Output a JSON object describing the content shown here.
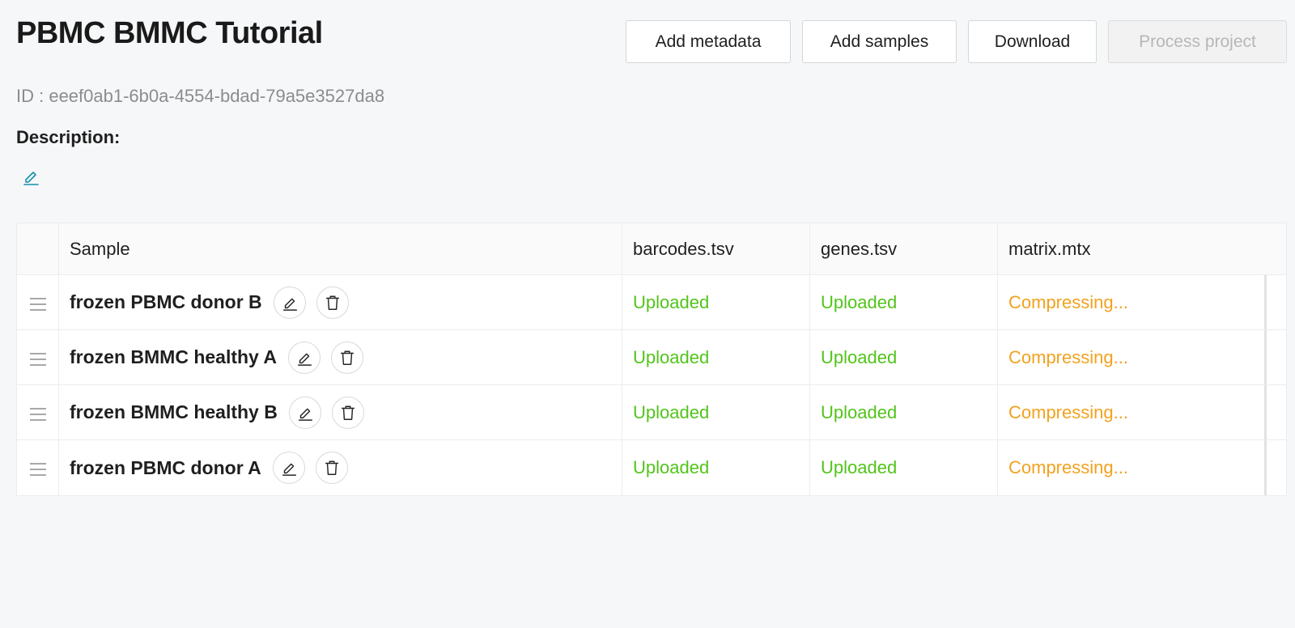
{
  "project": {
    "title": "PBMC BMMC Tutorial",
    "id_text": "ID : eeef0ab1-6b0a-4554-bdad-79a5e3527da8",
    "description_label": "Description:"
  },
  "toolbar": {
    "add_metadata": "Add metadata",
    "add_samples": "Add samples",
    "download": "Download",
    "process_project": "Process project"
  },
  "table": {
    "headers": {
      "sample": "Sample",
      "barcodes": "barcodes.tsv",
      "genes": "genes.tsv",
      "matrix": "matrix.mtx"
    },
    "rows": [
      {
        "name": "frozen PBMC donor B",
        "barcodes": "Uploaded",
        "genes": "Uploaded",
        "matrix": "Compressing..."
      },
      {
        "name": "frozen BMMC healthy A",
        "barcodes": "Uploaded",
        "genes": "Uploaded",
        "matrix": "Compressing..."
      },
      {
        "name": "frozen BMMC healthy B",
        "barcodes": "Uploaded",
        "genes": "Uploaded",
        "matrix": "Compressing..."
      },
      {
        "name": "frozen PBMC donor A",
        "barcodes": "Uploaded",
        "genes": "Uploaded",
        "matrix": "Compressing..."
      }
    ]
  },
  "colors": {
    "uploaded": "#52c41a",
    "compressing": "#f2a21f",
    "link_icon": "#1890a8"
  },
  "icons": {
    "description_edit": "pencil-icon",
    "row_drag": "drag-handle-icon",
    "row_edit": "pencil-icon",
    "row_delete": "trash-icon"
  }
}
